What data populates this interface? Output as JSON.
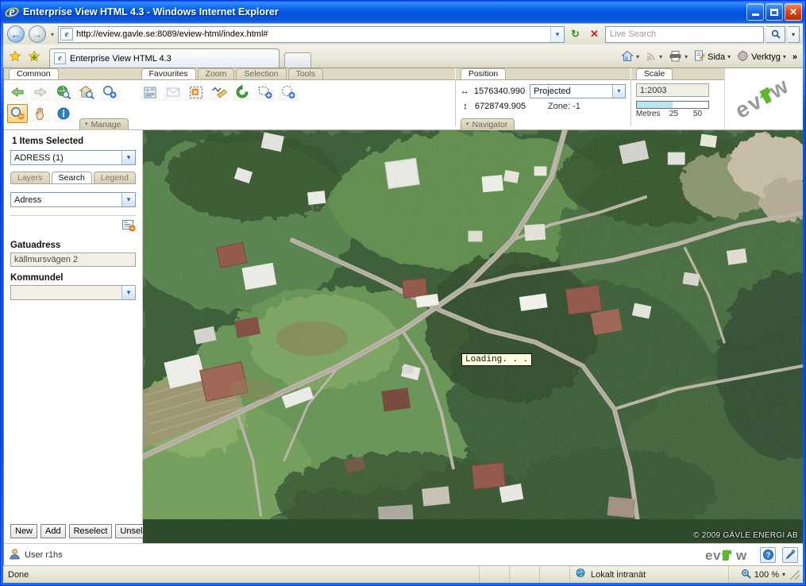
{
  "window": {
    "title": "Enterprise View HTML 4.3 - Windows Internet Explorer",
    "minimize_label": "Minimize",
    "maximize_label": "Maximize",
    "close_label": "Close"
  },
  "browser": {
    "back_label": "Back",
    "forward_label": "Forward",
    "history_caret": "▾",
    "url": "http://eview.gavle.se:8089/eview-html/index.html#",
    "url_dropdown": "▾",
    "refresh_label": "↻",
    "stop_label": "✕",
    "search_placeholder": "Live Search",
    "search_go": "search-icon",
    "search_caret": "▾",
    "favorites_star": "★",
    "add_favorite": "✚",
    "tab_title": "Enterprise View HTML 4.3",
    "commands": [
      {
        "icon": "home-icon",
        "label": "",
        "caret": "▾"
      },
      {
        "icon": "feeds-icon",
        "label": "",
        "caret": "▾"
      },
      {
        "icon": "print-icon",
        "label": "",
        "caret": "▾"
      },
      {
        "icon": "page-icon",
        "label": "Sida",
        "caret": "▾"
      },
      {
        "icon": "tools-icon",
        "label": "Verktyg",
        "caret": "▾"
      }
    ],
    "overflow": "»"
  },
  "toolbar": {
    "groups": [
      {
        "name": "common",
        "tabs": [
          {
            "label": "Common",
            "active": true
          }
        ],
        "row1": [
          {
            "name": "previous-view-icon",
            "enabled": true
          },
          {
            "name": "next-view-icon",
            "enabled": false
          },
          {
            "name": "zoom-full-extent-icon",
            "enabled": true
          },
          {
            "name": "zoom-home-icon",
            "enabled": true
          },
          {
            "name": "zoom-in-icon",
            "enabled": true
          }
        ],
        "row2": [
          {
            "name": "zoom-out-icon",
            "enabled": true,
            "pressed": true
          },
          {
            "name": "pan-hand-icon",
            "enabled": true
          },
          {
            "name": "identify-info-icon",
            "enabled": true
          }
        ],
        "pill": "Manage",
        "pill_caret": "▾"
      },
      {
        "name": "favourites",
        "tabs": [
          {
            "label": "Favourites",
            "active": true
          },
          {
            "label": "Zoom",
            "active": false
          },
          {
            "label": "Selection",
            "active": false
          },
          {
            "label": "Tools",
            "active": false
          }
        ],
        "row1": [
          {
            "name": "report-icon",
            "enabled": true
          },
          {
            "name": "email-icon",
            "enabled": false
          },
          {
            "name": "clear-selection-icon",
            "enabled": true
          },
          {
            "name": "measure-ruler-icon",
            "enabled": true
          },
          {
            "name": "refresh-map-icon",
            "enabled": true
          },
          {
            "name": "select-polygon-add-icon",
            "enabled": true
          },
          {
            "name": "select-circle-add-icon",
            "enabled": true
          }
        ],
        "row2": []
      }
    ]
  },
  "position": {
    "tab_label": "Position",
    "x_icon": "horizontal-arrows-icon",
    "x_value": "1576340.990",
    "y_icon": "vertical-arrows-icon",
    "y_value": "6728749.905",
    "projection": "Projected",
    "projection_caret": "▾",
    "zone_label": "Zone: -1",
    "pill": "Navigator",
    "pill_caret": "▾"
  },
  "scale": {
    "tab_label": "Scale",
    "value": "1:2003",
    "unit_label": "Metres",
    "tick_mid": "25",
    "tick_end": "50",
    "bar_fill_percent": 50
  },
  "brand": {
    "logo_alt": "eview-logo"
  },
  "sidebar": {
    "items_selected": "1 Items Selected",
    "selection_combo": "ADRESS (1)",
    "selection_caret": "▾",
    "tabs": [
      {
        "label": "Layers",
        "active": false
      },
      {
        "label": "Search",
        "active": true
      },
      {
        "label": "Legend",
        "active": false
      }
    ],
    "search_type": "Adress",
    "search_type_caret": "▾",
    "clear_query_icon": "clear-query-icon",
    "fields": [
      {
        "label": "Gatuadress",
        "value": "källmursvägen 2",
        "type": "text"
      },
      {
        "label": "Kommundel",
        "value": "",
        "type": "combo",
        "caret": "▾"
      }
    ],
    "buttons": [
      "New",
      "Add",
      "Reselect",
      "Unselect"
    ]
  },
  "map": {
    "loading_text": "Loading. . .",
    "copyright": "© 2009 GÄVLE ENERGI AB"
  },
  "appstatus": {
    "user_icon": "user-icon",
    "user_label": "User r1hs",
    "logo_alt": "eview-logo",
    "help_icon": "help-icon",
    "tools_icon": "pen-tool-icon"
  },
  "statusbar": {
    "status_text": "Done",
    "zone_icon": "globe-icon",
    "zone_text": "Lokalt intranät",
    "zoom_icon": "zoom-icon",
    "zoom_level": "100 %",
    "zoom_caret": "▾"
  },
  "colors": {
    "title_blue": "#0054e3",
    "chrome_beige": "#ece9d8",
    "accent_green": "#4ca64c",
    "tooltip_bg": "#ffffdf",
    "scalebar_fill": "#b8e5f0"
  }
}
